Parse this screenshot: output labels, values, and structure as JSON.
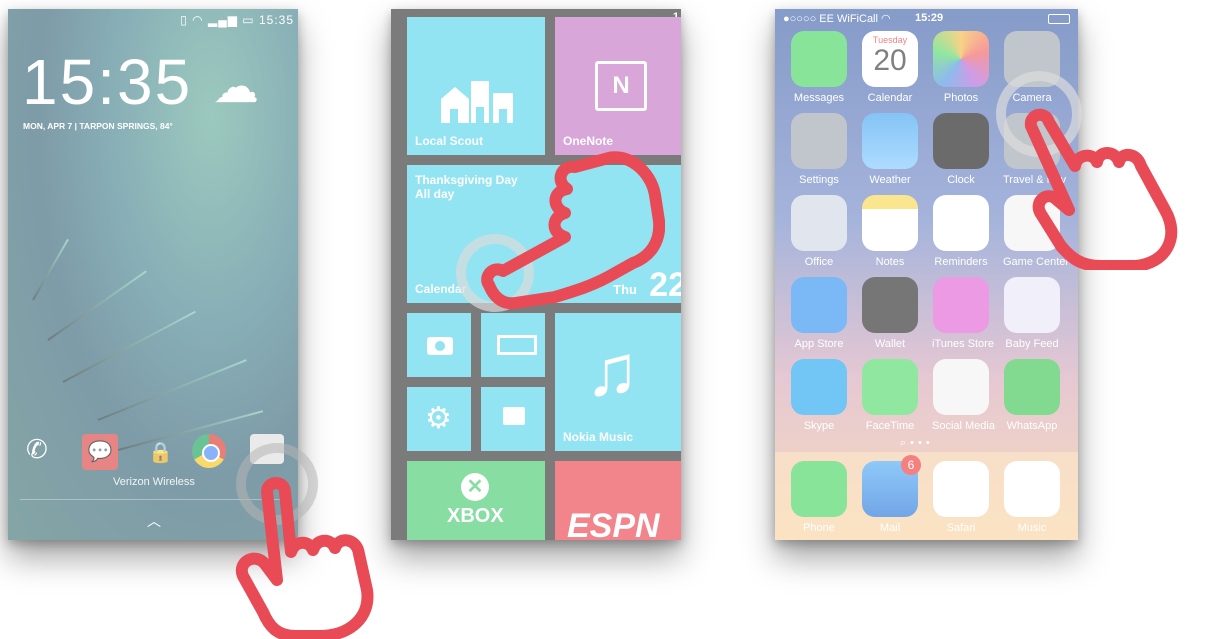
{
  "android": {
    "time": "15:35",
    "date": "MON, APR 7 | TARPON SPRINGS, 84°",
    "status_time": "15:35",
    "carrier": "Verizon Wireless"
  },
  "winphone": {
    "status_time": "1",
    "tiles": {
      "local_scout": "Local Scout",
      "onenote": "OneNote",
      "event_title": "Thanksgiving Day",
      "event_when": "All day",
      "calendar": "Calendar",
      "calendar_day": "Thu",
      "calendar_date": "22",
      "nokia_music": "Nokia Music",
      "xbox": "XBOX",
      "espn": "ESPN"
    }
  },
  "iphone": {
    "carrier": "●○○○○ EE WiFiCall",
    "time": "15:29",
    "calendar_weekday": "Tuesday",
    "calendar_day": "20",
    "mail_badge": "6",
    "apps": [
      "Messages",
      "Calendar",
      "Photos",
      "Camera",
      "Settings",
      "Weather",
      "Clock",
      "Travel & Nav",
      "Office",
      "Notes",
      "Reminders",
      "Game Center",
      "App Store",
      "Wallet",
      "iTunes Store",
      "Baby Feed",
      "Skype",
      "FaceTime",
      "Social Media",
      "WhatsApp"
    ],
    "dock": [
      "Phone",
      "Mail",
      "Safari",
      "Music"
    ]
  },
  "colors": {
    "tile_cyan": "#4fd3ea",
    "tile_purple": "#c070c0",
    "tile_green": "#3ec86a",
    "tile_red": "#e83a44",
    "hand_red": "#e84b55"
  }
}
